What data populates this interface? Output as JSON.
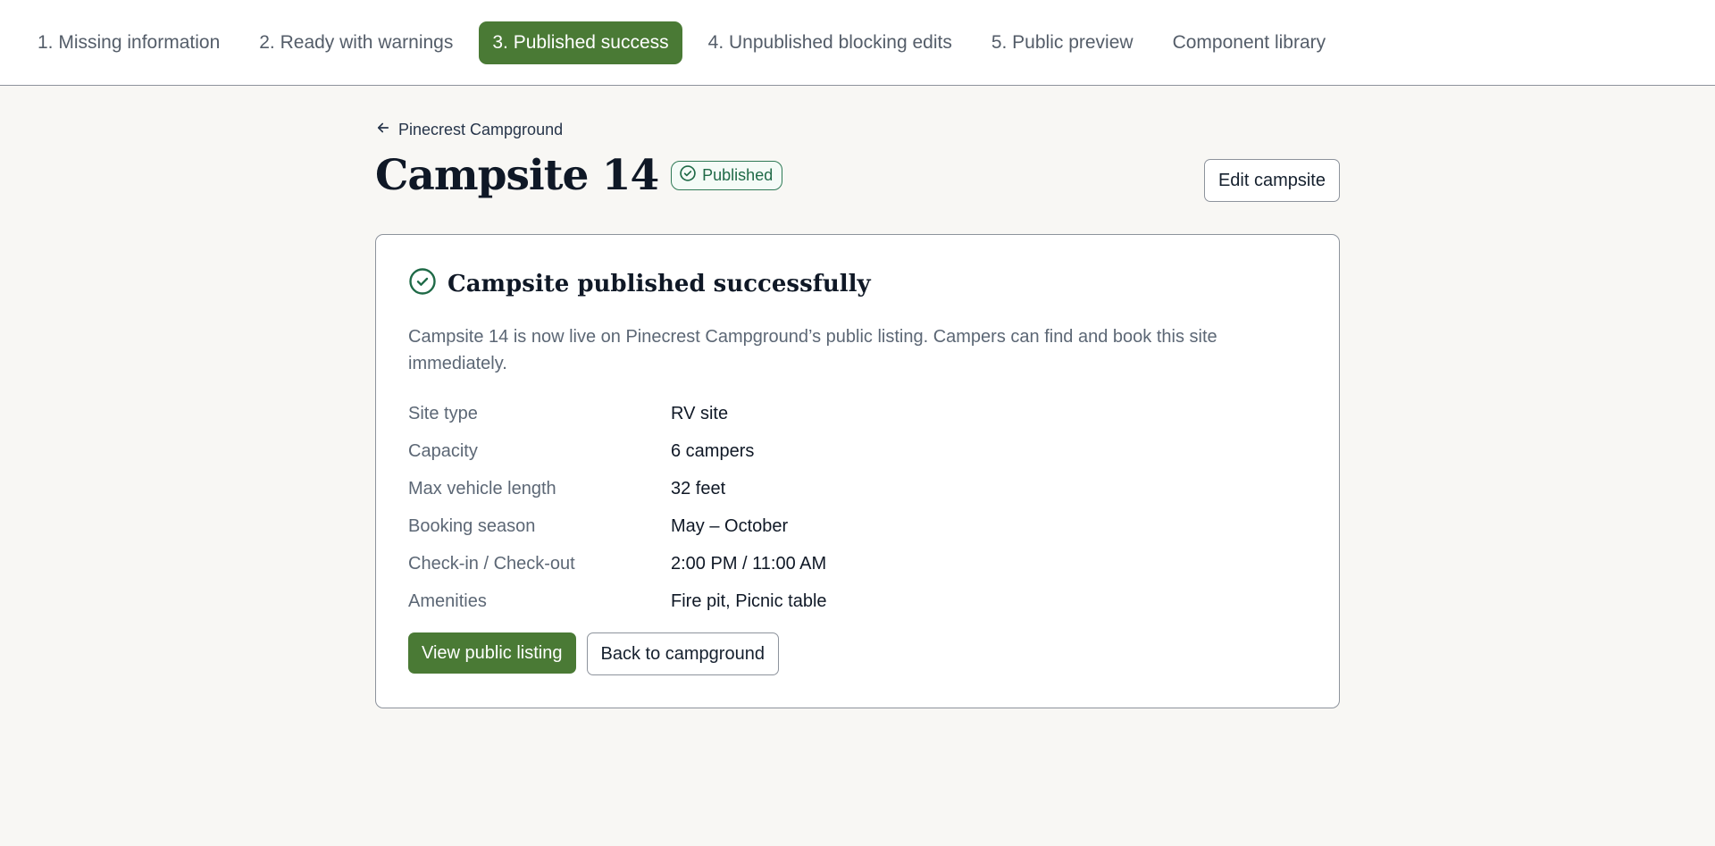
{
  "nav": {
    "tabs": [
      {
        "label": "1. Missing information"
      },
      {
        "label": "2. Ready with warnings"
      },
      {
        "label": "3. Published success"
      },
      {
        "label": "4. Unpublished blocking edits"
      },
      {
        "label": "5. Public preview"
      },
      {
        "label": "Component library"
      }
    ],
    "active_index": 2
  },
  "breadcrumb": {
    "label": "Pinecrest Campground",
    "icon": "arrow-left-icon"
  },
  "header": {
    "title": "Campsite 14",
    "status_badge": "Published",
    "status_icon": "check-circle-icon",
    "edit_button": "Edit campsite"
  },
  "card": {
    "icon": "check-circle-icon",
    "title": "Campsite published successfully",
    "description": "Campsite 14 is now live on Pinecrest Campground’s public listing. Campers can find and book this site immediately.",
    "details": [
      {
        "label": "Site type",
        "value": "RV site"
      },
      {
        "label": "Capacity",
        "value": "6 campers"
      },
      {
        "label": "Max vehicle length",
        "value": "32 feet"
      },
      {
        "label": "Booking season",
        "value": "May – October"
      },
      {
        "label": "Check-in / Check-out",
        "value": "2:00 PM / 11:00 AM"
      },
      {
        "label": "Amenities",
        "value": "Fire pit, Picnic table"
      }
    ],
    "primary_button": "View public listing",
    "secondary_button": "Back to campground"
  },
  "colors": {
    "accent": "#4a7a35",
    "success": "#1f6a47",
    "background": "#f8f7f4"
  }
}
